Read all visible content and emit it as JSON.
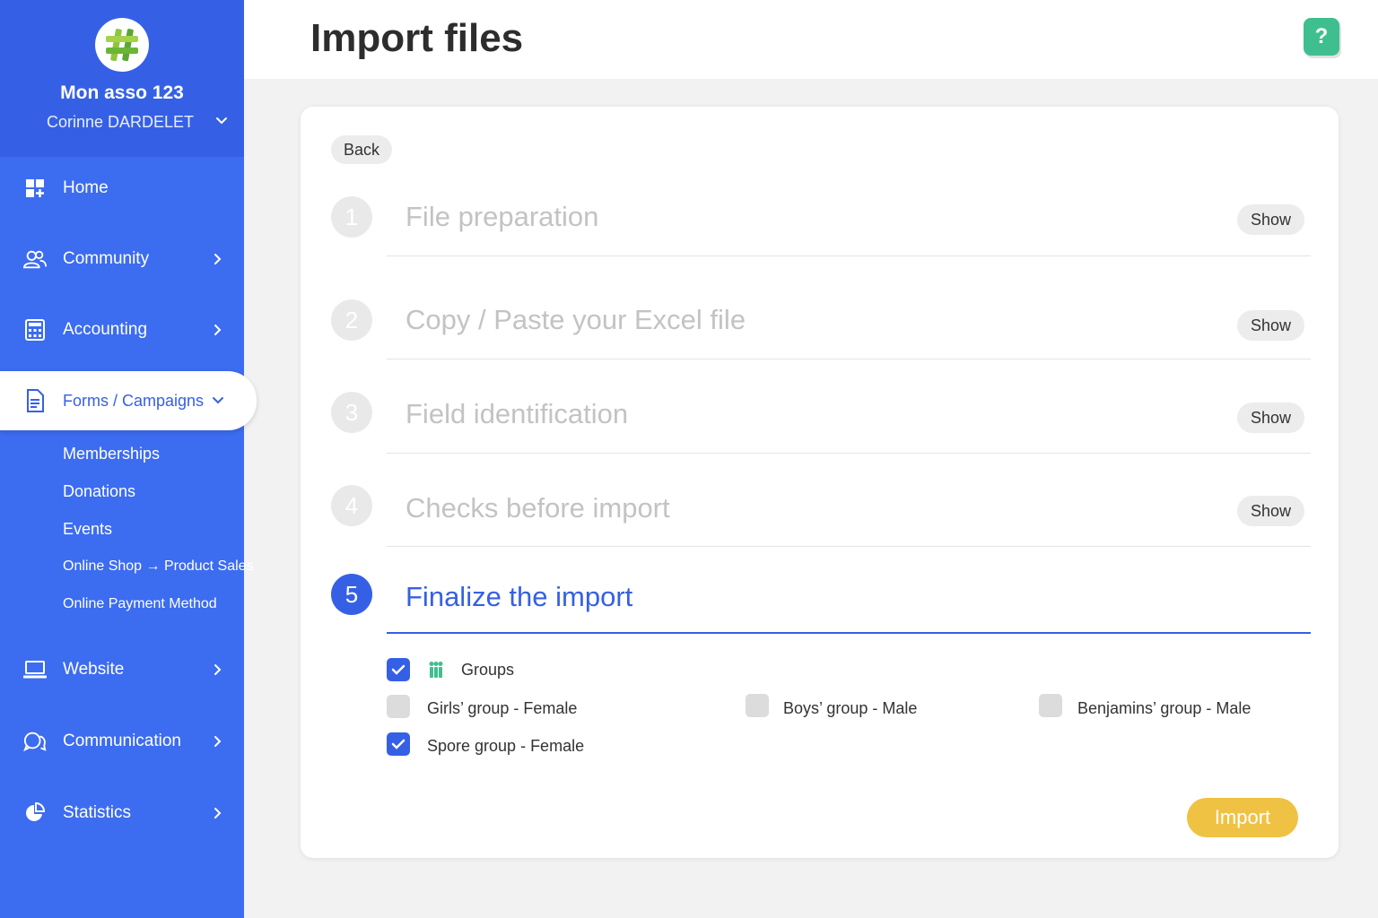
{
  "sidebar": {
    "org_name": "Mon asso 123",
    "user_name": "Corinne DARDELET",
    "items": [
      {
        "label": "Home",
        "icon": "dashboard-icon"
      },
      {
        "label": "Community",
        "icon": "users-icon"
      },
      {
        "label": "Accounting",
        "icon": "calculator-icon"
      },
      {
        "label": "Forms / Campaigns",
        "icon": "document-icon",
        "active": true
      },
      {
        "label": "Website",
        "icon": "laptop-icon"
      },
      {
        "label": "Communication",
        "icon": "chat-icon"
      },
      {
        "label": "Statistics",
        "icon": "pie-chart-icon"
      }
    ],
    "sub_items": [
      "Memberships",
      "Donations",
      "Events",
      "Online Shop → Product Sales",
      "Online Payment Method"
    ]
  },
  "header": {
    "title": "Import files",
    "help_label": "?"
  },
  "main": {
    "back_label": "Back",
    "steps": [
      {
        "number": "1",
        "title": "File preparation",
        "action": "Show"
      },
      {
        "number": "2",
        "title": "Copy / Paste your Excel file",
        "action": "Show"
      },
      {
        "number": "3",
        "title": "Field identification",
        "action": "Show"
      },
      {
        "number": "4",
        "title": "Checks before import",
        "action": "Show"
      },
      {
        "number": "5",
        "title": "Finalize the import",
        "active": true
      }
    ],
    "groups_section": {
      "label": "Groups",
      "checked": true,
      "options": [
        {
          "label": "Girls’ group - Female",
          "checked": false
        },
        {
          "label": "Boys’ group - Male",
          "checked": false
        },
        {
          "label": "Benjamins’ group - Male",
          "checked": false
        },
        {
          "label": "Spore group - Female",
          "checked": true
        }
      ]
    },
    "import_label": "Import"
  },
  "colors": {
    "primary": "#3c6cf0",
    "accent_green": "#3fbf8f",
    "import_yellow": "#f0c243"
  }
}
